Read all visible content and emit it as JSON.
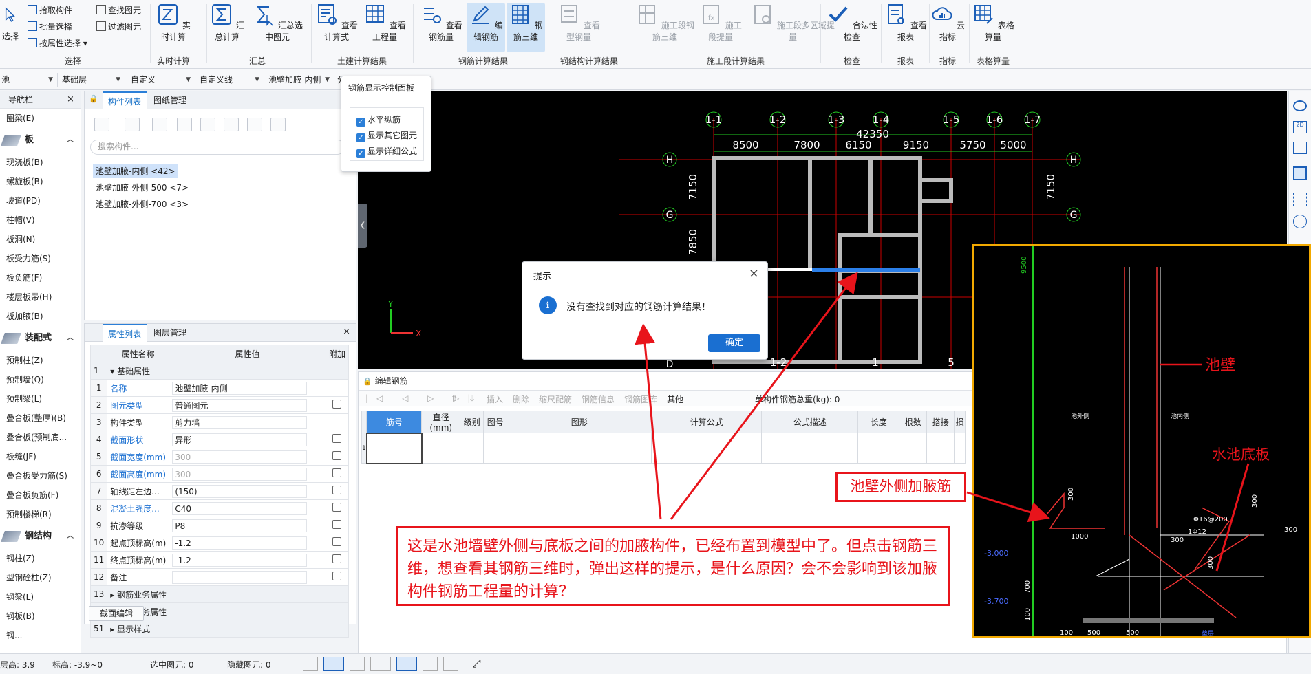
{
  "ribbon": {
    "select": {
      "label": "选择",
      "pick": "拾取构件",
      "batch": "批量选择",
      "by_attr": "按属性选择",
      "find": "查找图元",
      "filter": "过滤图元",
      "group": "选择"
    },
    "realtime": {
      "label": "实时计算",
      "group": "实时计算"
    },
    "summary": {
      "calc": "汇总计算",
      "calc_sel": "汇总选中图元",
      "group": "汇总"
    },
    "civil": {
      "view_formula": "查看计算式",
      "view_qty": "查看工程量",
      "group": "土建计算结果"
    },
    "rebar": {
      "view_rebar": "查看钢筋量",
      "edit_rebar": "编辑钢筋",
      "rebar_3d": "钢筋三维",
      "group": "钢筋计算结果"
    },
    "steel": {
      "view_steel": "查看型钢量",
      "group": "钢结构计算结果"
    },
    "stage": {
      "rebar_3d": "施工段钢筋三维",
      "extract": "施工段提量",
      "multi": "施工段多区域提量",
      "group": "施工段计算结果"
    },
    "check": {
      "label": "合法性检查",
      "group": "检查"
    },
    "report": {
      "label": "查看报表",
      "group": "报表"
    },
    "index": {
      "label": "云指标",
      "group": "指标"
    },
    "table": {
      "label": "表格算量",
      "group": "表格算量"
    }
  },
  "filterbar": {
    "c1": "池",
    "c2": "基础层",
    "c3": "自定义",
    "c4": "自定义线",
    "c5": "池壁加腋-内侧",
    "c6": "分"
  },
  "nav": {
    "title": "导航栏",
    "items_top": [
      "圈梁(E)"
    ],
    "cat_slab": "板",
    "slab_items": [
      "现浇板(B)",
      "螺旋板(B)",
      "坡道(PD)",
      "柱帽(V)",
      "板洞(N)",
      "板受力筋(S)",
      "板负筋(F)",
      "楼层板带(H)",
      "板加腋(B)"
    ],
    "cat_prefab": "装配式",
    "prefab_items": [
      "预制柱(Z)",
      "预制墙(Q)",
      "预制梁(L)",
      "叠合板(整厚)(B)",
      "叠合板(预制底...",
      "板缝(JF)",
      "叠合板受力筋(S)",
      "叠合板负筋(F)",
      "预制楼梯(R)"
    ],
    "cat_steel": "钢结构",
    "steel_items": [
      "钢柱(Z)",
      "型钢砼柱(Z)",
      "钢梁(L)",
      "钢板(B)",
      "钢..."
    ]
  },
  "complist": {
    "tab1": "构件列表",
    "tab2": "图纸管理",
    "search_placeholder": "搜索构件...",
    "items": [
      "池壁加腋-内侧 <42>",
      "池壁加腋-外侧-500 <7>",
      "池壁加腋-外侧-700 <3>"
    ]
  },
  "props": {
    "tab1": "属性列表",
    "tab2": "图层管理",
    "headers": [
      "属性名称",
      "属性值",
      "附加"
    ],
    "section_basic": "基础属性",
    "rows": [
      {
        "n": "1",
        "name": "名称",
        "value": "池壁加腋-内侧"
      },
      {
        "n": "2",
        "name": "图元类型",
        "value": "普通图元"
      },
      {
        "n": "3",
        "name": "构件类型",
        "value": "剪力墙"
      },
      {
        "n": "4",
        "name": "截面形状",
        "value": "异形"
      },
      {
        "n": "5",
        "name": "截面宽度(mm)",
        "value": "300"
      },
      {
        "n": "6",
        "name": "截面高度(mm)",
        "value": "300"
      },
      {
        "n": "7",
        "name": "轴线距左边...",
        "value": "(150)"
      },
      {
        "n": "8",
        "name": "混凝土强度...",
        "value": "C40"
      },
      {
        "n": "9",
        "name": "抗渗等级",
        "value": "P8"
      },
      {
        "n": "10",
        "name": "起点顶标高(m)",
        "value": "-1.2"
      },
      {
        "n": "11",
        "name": "终点顶标高(m)",
        "value": "-1.2"
      },
      {
        "n": "12",
        "name": "备注",
        "value": ""
      }
    ],
    "sec2": "钢筋业务属性",
    "sec3": "土建业务属性",
    "sec4": "显示样式",
    "section_edit": "截面编辑"
  },
  "ctrlpanel": {
    "title": "钢筋显示控制面板",
    "opt1": "水平纵筋",
    "opt2": "显示其它图元",
    "opt3": "显示详细公式"
  },
  "canvas": {
    "axes_top": [
      "1-1",
      "1-2",
      "1-3",
      "1-4",
      "1-5",
      "1-6",
      "1-7"
    ],
    "total_dim": "42350",
    "dims_top": [
      "8500",
      "7800",
      "6150",
      "9150",
      "5750",
      "5000"
    ],
    "axes_side": [
      "H",
      "G",
      "D"
    ],
    "dims_left": [
      "7150",
      "7850"
    ],
    "dims_right": [
      "7150"
    ],
    "bottom_axes": [
      "1-2",
      "1",
      "5"
    ]
  },
  "dialog": {
    "title": "提示",
    "message": "没有查找到对应的钢筋计算结果！",
    "ok": "确定"
  },
  "rebar_panel": {
    "title": "编辑钢筋",
    "toolbar": [
      "插入",
      "删除",
      "缩尺配筋",
      "钢筋信息",
      "钢筋图库",
      "其他"
    ],
    "total": "单构件钢筋总重(kg): 0",
    "headers": [
      "筋号",
      "直径(mm)",
      "级别",
      "图号",
      "图形",
      "计算公式",
      "公式描述",
      "长度",
      "根数",
      "搭接",
      "损"
    ],
    "row1": "1"
  },
  "status": {
    "floor_h": "层高:  3.9",
    "elev": "标高:  -3.9~0",
    "selected": "选中图元:  0",
    "hidden": "隐藏图元:  0"
  },
  "annotation": {
    "note": "这是水池墙壁外侧与底板之间的加腋构件，已经布置到模型中了。但点击钢筋三维，想查看其钢筋三维时，弹出这样的提示，是什么原因？会不会影响到该加腋构件钢筋工程量的计算？",
    "wing_label": "池壁外侧加腋筋",
    "wall_label": "池壁",
    "slab_label": "水池底板"
  },
  "detail": {
    "dims": [
      "9500",
      "300",
      "1000",
      "300",
      "700",
      "100",
      "300",
      "300",
      "300",
      "100",
      "500",
      "500"
    ],
    "rebar_text": [
      "Φ16@200",
      "1Φ12"
    ],
    "elev": [
      "-3.000",
      "-3.700"
    ],
    "text_small": [
      "池外侧",
      "池内侧",
      "垫层"
    ]
  },
  "colors": {
    "accent": "#2b7fd8",
    "annotation": "#e8141b",
    "detail_border": "#f2a900"
  }
}
